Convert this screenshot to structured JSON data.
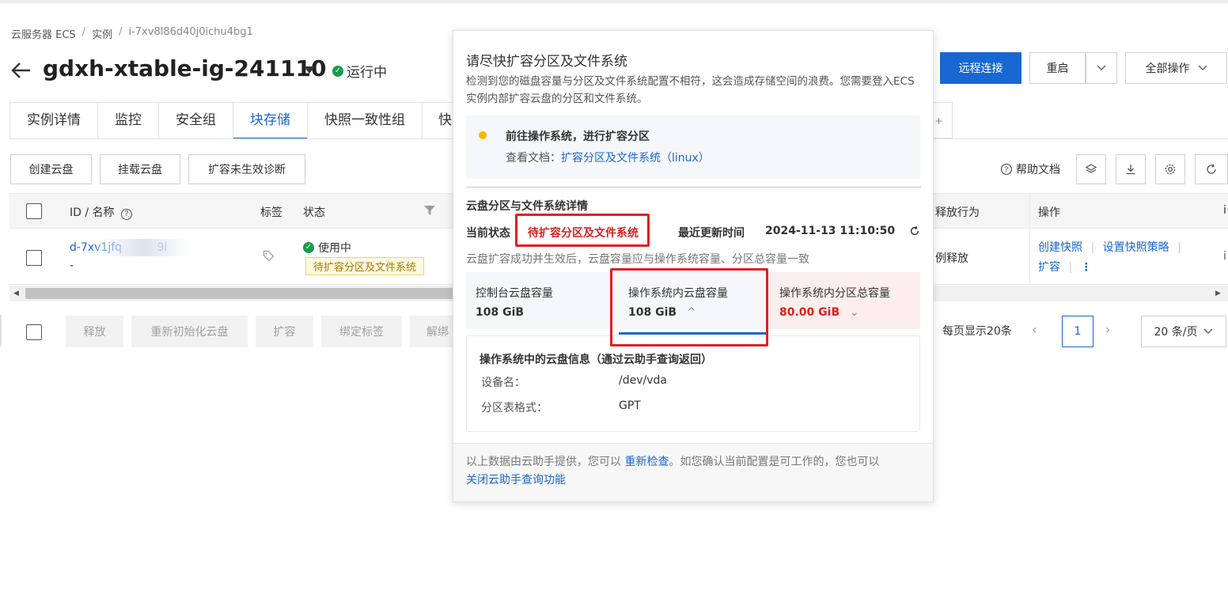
{
  "breadcrumb": [
    "云服务器 ECS",
    "实例",
    "i-7xv8l86d40j0ichu4bg1"
  ],
  "header": {
    "title": "gdxh-xtable-ig-241110",
    "status": "运行中",
    "buttons": {
      "remote": "远程连接",
      "restart": "重启",
      "all_ops": "全部操作"
    }
  },
  "tabs": [
    "实例详情",
    "监控",
    "安全组",
    "块存储",
    "快照一致性组",
    "快"
  ],
  "tab_active": "块存储",
  "toolbar": {
    "create": "创建云盘",
    "mount": "挂载云盘",
    "diagnose": "扩容未生效诊断",
    "help": "帮助文档"
  },
  "table": {
    "columns": {
      "id": "ID / 名称",
      "tag": "标签",
      "status": "状态",
      "release": "释放行为",
      "ops": "操作"
    },
    "row": {
      "id": "d-7xv1jfq          9i",
      "name": "-",
      "status": "使用中",
      "status_tag": "待扩容分区及文件系统",
      "release": "例释放",
      "op_snapshot": "创建快照",
      "op_policy": "设置快照策略",
      "op_expand": "扩容",
      "op_more": "⋮"
    }
  },
  "batch": {
    "release": "释放",
    "reinit": "重新初始化云盘",
    "expand": "扩容",
    "bind_tag": "绑定标签",
    "unmount": "解绑"
  },
  "pagination": {
    "per_page_text": "每页显示20条",
    "page": "1",
    "size": "20 条/页"
  },
  "popup": {
    "title": "请尽快扩容分区及文件系统",
    "desc": "检测到您的磁盘容量与分区及文件系统配置不相符，这会造成存储空间的浪费。您需要登入ECS实例内部扩容云盘的分区和文件系统。",
    "step_title": "前往操作系统，进行扩容分区",
    "step_doc_label": "查看文档：",
    "step_doc_link": "扩容分区及文件系统（linux）",
    "section_title": "云盘分区与文件系统详情",
    "current_label": "当前状态",
    "current_value": "待扩容分区及文件系统",
    "updated_label": "最近更新时间",
    "updated_value": "2024-11-13 11:10:50",
    "hint": "云盘扩容成功并生效后，云盘容量应与操作系统容量、分区总容量一致",
    "metrics": [
      {
        "label": "控制台云盘容量",
        "value": "108 GiB"
      },
      {
        "label": "操作系统内云盘容量",
        "value": "108 GiB",
        "suffix": "^"
      },
      {
        "label": "操作系统内分区总容量",
        "value": "80.00 GiB",
        "suffix": "⌄"
      }
    ],
    "info_title": "操作系统中的云盘信息（通过云助手查询返回）",
    "device_label": "设备名：",
    "device_value": "/dev/vda",
    "ptable_label": "分区表格式：",
    "ptable_value": "GPT",
    "foot_text": "以上数据由云助手提供，您可以 ",
    "foot_link1": "重新检查",
    "foot_text2": "。如您确认当前配置是可工作的，您也可以",
    "foot_link2": "关闭云助手查询功能"
  },
  "colors": {
    "primary": "#1967d2",
    "danger": "#d92121",
    "success": "#1a9c4a",
    "warning": "#f5b800"
  }
}
